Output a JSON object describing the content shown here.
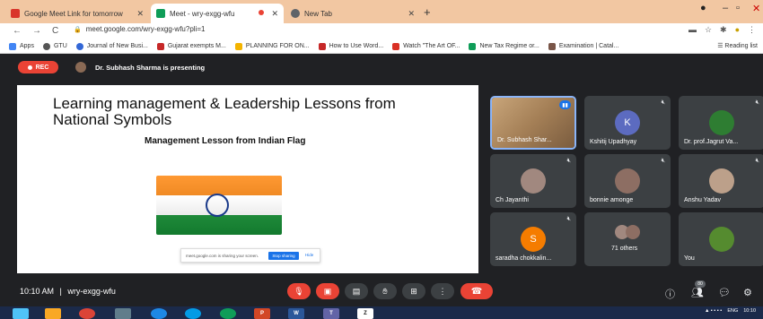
{
  "browser": {
    "tabs": [
      {
        "title": "Google Meet Link for tomorrow",
        "favicon_color": "#d9352b"
      },
      {
        "title": "Meet - wry-exgg-wfu",
        "favicon_color": "#0f9d58",
        "recording_dot_color": "#ea4335"
      },
      {
        "title": "New Tab",
        "favicon_color": "#5f6368"
      }
    ],
    "new_tab_label": "+",
    "url": "meet.google.com/wry-exgg-wfu?pli=1",
    "bookmarks": [
      {
        "label": "Apps",
        "icon_color": "#4285f4"
      },
      {
        "label": "GTU",
        "icon_color": "#555555"
      },
      {
        "label": "Journal of New Busi...",
        "icon_color": "#3367d6"
      },
      {
        "label": "Gujarat exempts M...",
        "icon_color": "#c62828"
      },
      {
        "label": "PLANNING FOR ON...",
        "icon_color": "#f4b400"
      },
      {
        "label": "How to Use Word...",
        "icon_color": "#c62828"
      },
      {
        "label": "Watch \"The Art OF...",
        "icon_color": "#d93025"
      },
      {
        "label": "New Tax Regime or...",
        "icon_color": "#0f9d58"
      },
      {
        "label": "Examination | Catal...",
        "icon_color": "#795548"
      }
    ],
    "reading_list_label": "Reading list"
  },
  "meet": {
    "rec_label": "REC",
    "presenter_text": "Dr. Subhash Sharma is presenting",
    "slide": {
      "title": "Learning management & Leadership Lessons from National Symbols",
      "subtitle": "Management Lesson from Indian Flag",
      "share_text": "meet.google.com is sharing your screen.",
      "stop_label": "Stop sharing",
      "hide_label": "Hide"
    },
    "tiles": [
      {
        "name": "Dr. Subhash Shar...",
        "type": "video",
        "speaking": true
      },
      {
        "name": "Kshitij Upadhyay",
        "initial": "K",
        "avatar_color": "#5c6bc0"
      },
      {
        "name": "Dr. prof.Jagrut Va...",
        "avatar_color": "#2e7d32"
      },
      {
        "name": "Ch Jayanthi",
        "avatar_color": "#a1887f"
      },
      {
        "name": "bonnie amonge",
        "avatar_color": "#8d6e63"
      },
      {
        "name": "Anshu Yadav",
        "avatar_color": "#bca08a"
      },
      {
        "name": "saradha chokkalin...",
        "initial": "S",
        "avatar_color": "#f57c00"
      },
      {
        "name": "71 others",
        "avatar_color": "#a1887f"
      },
      {
        "name": "You",
        "avatar_color": "#558b2f"
      }
    ],
    "bottom": {
      "time": "10:10 AM",
      "separator": "|",
      "meeting_code": "wry-exgg-wfu",
      "participant_count": "80"
    }
  },
  "taskbar": {
    "apps": [
      {
        "icon": "windows-start-icon",
        "color": "#4fc3f7"
      },
      {
        "icon": "file-explorer-icon",
        "color": "#f9a825"
      },
      {
        "icon": "chrome-icon",
        "color": "#db4437"
      },
      {
        "icon": "calculator-icon",
        "color": "#607d8b"
      },
      {
        "icon": "edge-icon",
        "color": "#1e88e5"
      },
      {
        "icon": "skype-icon",
        "color": "#039be5"
      },
      {
        "icon": "chrome-alt-icon",
        "color": "#0f9d58"
      },
      {
        "label": "P",
        "icon": "powerpoint-icon",
        "color": "#d24726"
      },
      {
        "label": "W",
        "icon": "word-icon",
        "color": "#2b579a"
      },
      {
        "label": "T",
        "icon": "teams-icon",
        "color": "#6264a7"
      },
      {
        "label": "Z",
        "icon": "zoom-icon",
        "color": "#ffffff"
      }
    ],
    "lang": "ENG",
    "clock": "10:10"
  }
}
